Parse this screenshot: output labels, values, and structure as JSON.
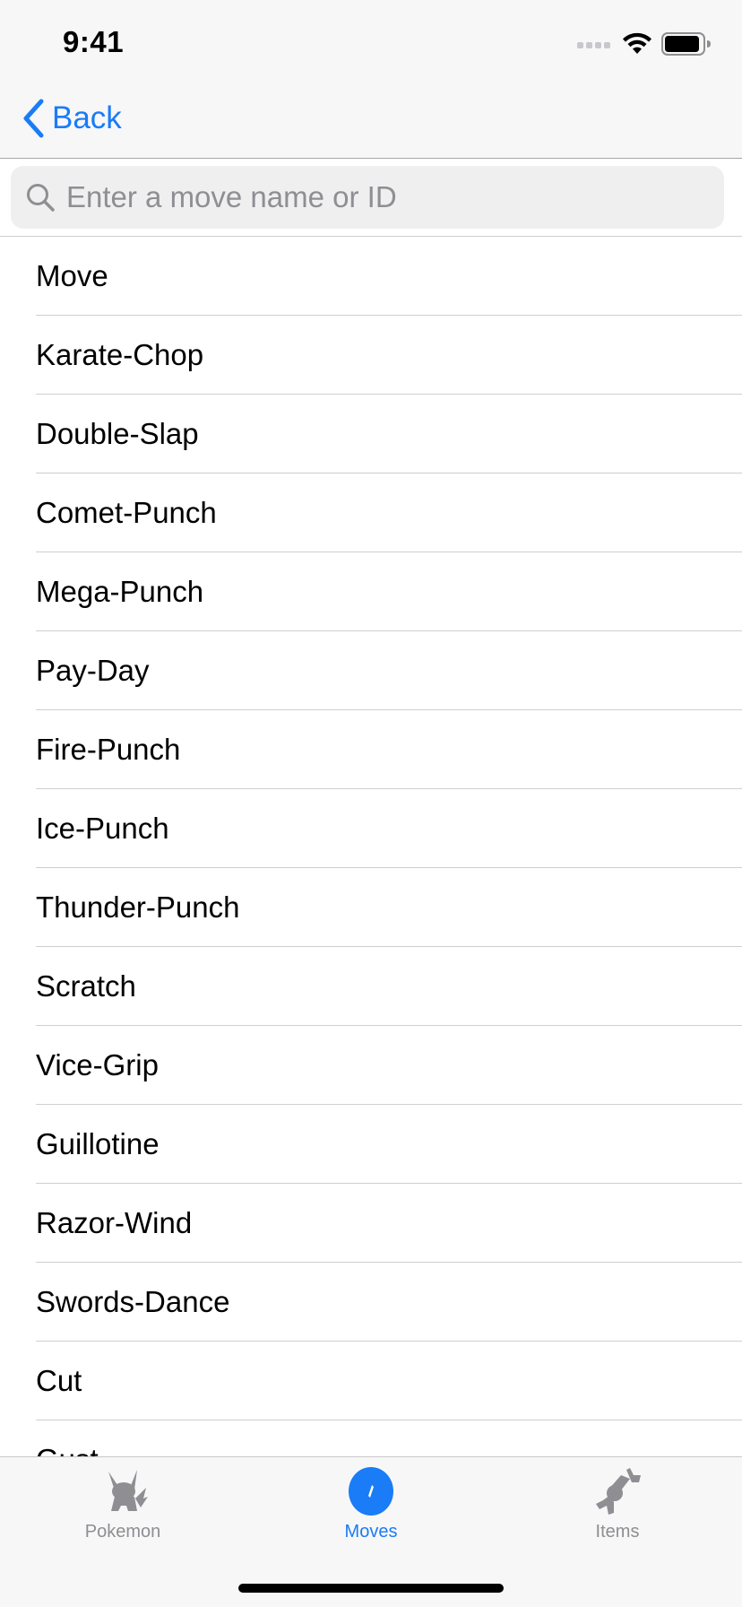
{
  "status_bar": {
    "time": "9:41"
  },
  "nav": {
    "back_label": "Back"
  },
  "search": {
    "placeholder": "Enter a move name or ID",
    "value": ""
  },
  "moves": [
    "Move",
    "Karate-Chop",
    "Double-Slap",
    "Comet-Punch",
    "Mega-Punch",
    "Pay-Day",
    "Fire-Punch",
    "Ice-Punch",
    "Thunder-Punch",
    "Scratch",
    "Vice-Grip",
    "Guillotine",
    "Razor-Wind",
    "Swords-Dance",
    "Cut",
    "Gust"
  ],
  "tabs": [
    {
      "label": "Pokemon",
      "icon": "pikachu-icon",
      "active": false
    },
    {
      "label": "Moves",
      "icon": "disc-icon",
      "active": true
    },
    {
      "label": "Items",
      "icon": "candy-icon",
      "active": false
    }
  ],
  "colors": {
    "accent": "#1a7cf6",
    "inactive": "#8e8e93",
    "bar_background": "#f7f7f7"
  }
}
